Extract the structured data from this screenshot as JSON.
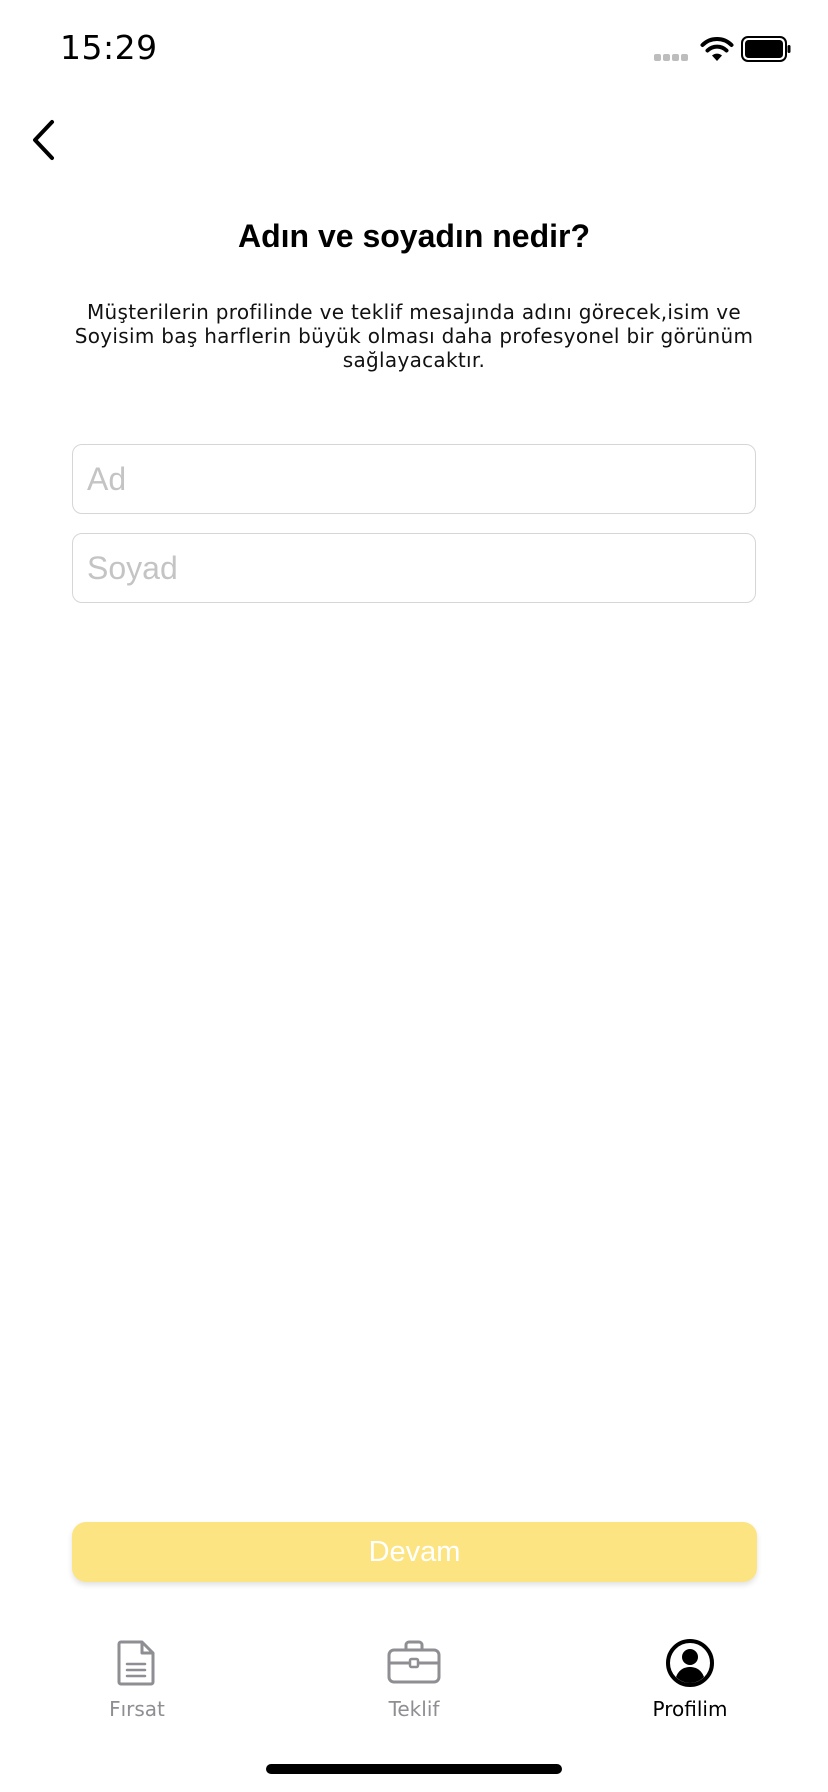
{
  "status_bar": {
    "time": "15:29",
    "icons": [
      "cellular-signal-icon",
      "wifi-icon",
      "battery-icon"
    ]
  },
  "nav": {
    "back_icon": "chevron-left-icon"
  },
  "main": {
    "title": "Adın ve soyadın nedir?",
    "description": "Müşterilerin profilinde ve teklif mesajında adını görecek,isim ve Soyisim baş harflerin büyük olması daha profesyonel bir görünüm sağlayacaktır.",
    "first_name": {
      "placeholder": "Ad",
      "value": ""
    },
    "last_name": {
      "placeholder": "Soyad",
      "value": ""
    },
    "continue_label": "Devam"
  },
  "tabs": [
    {
      "label": "Fırsat",
      "icon": "document-icon",
      "active": false
    },
    {
      "label": "Teklif",
      "icon": "briefcase-icon",
      "active": false
    },
    {
      "label": "Profilim",
      "icon": "user-circle-icon",
      "active": true
    }
  ],
  "colors": {
    "accent_button": "#fce483",
    "tab_inactive": "#8e8e93",
    "tab_active": "#000000",
    "field_border": "#d6d6d6"
  }
}
